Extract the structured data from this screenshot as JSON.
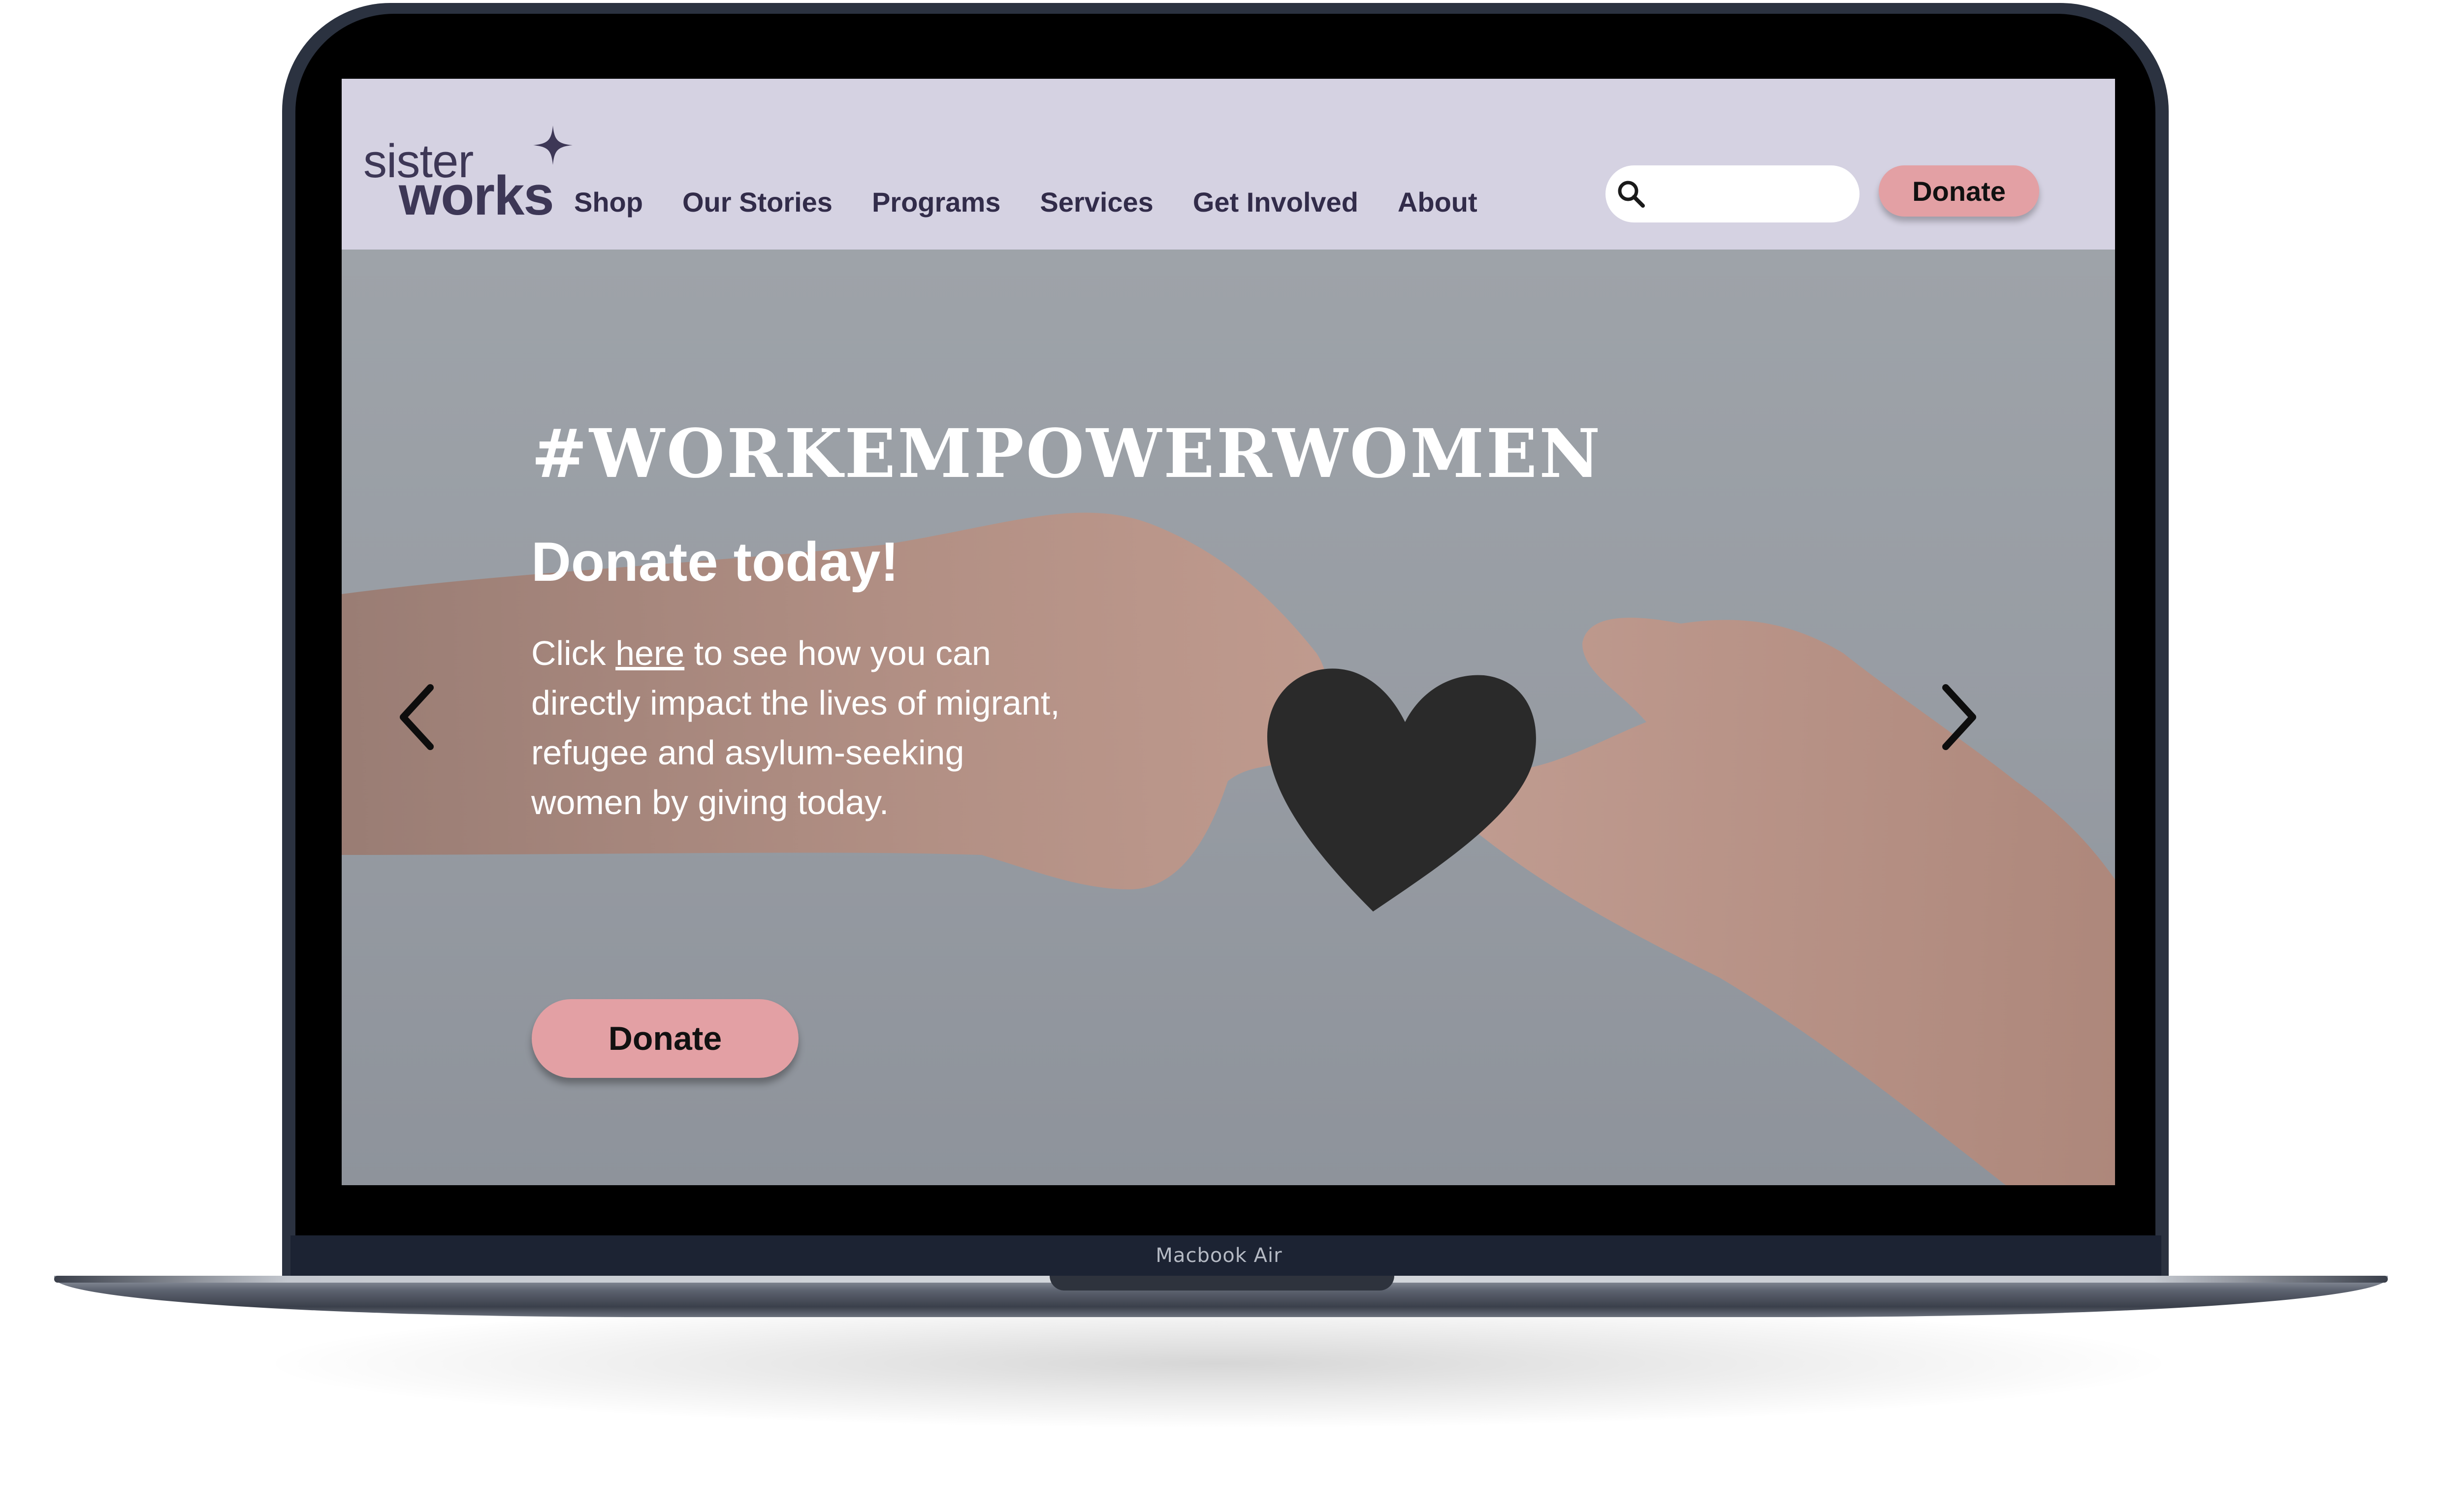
{
  "device": {
    "model_label": "Macbook Air"
  },
  "site": {
    "logo": {
      "line1": "sister",
      "line2": "works"
    },
    "nav": {
      "items": [
        {
          "label": "Shop"
        },
        {
          "label": "Our Stories"
        },
        {
          "label": "Programs"
        },
        {
          "label": "Services"
        },
        {
          "label": "Get Involved"
        },
        {
          "label": "About"
        }
      ],
      "search": {
        "icon": "search-icon",
        "value": ""
      },
      "donate_label": "Donate"
    },
    "hero": {
      "hashtag": "#WORKEMPOWERWOMEN",
      "heading": "Donate today!",
      "body_prefix": "Click ",
      "body_link": "here",
      "body_suffix": " to see how you can directly impact the lives of migrant, refugee and asylum-seeking women by giving today.",
      "donate_label": "Donate",
      "prev_icon": "chevron-left-icon",
      "next_icon": "chevron-right-icon"
    }
  },
  "colors": {
    "nav_background": "#d5d2e2",
    "brand_text": "#322c4a",
    "button_pink": "#e3a0a4",
    "device_frame": "#2b3240"
  }
}
